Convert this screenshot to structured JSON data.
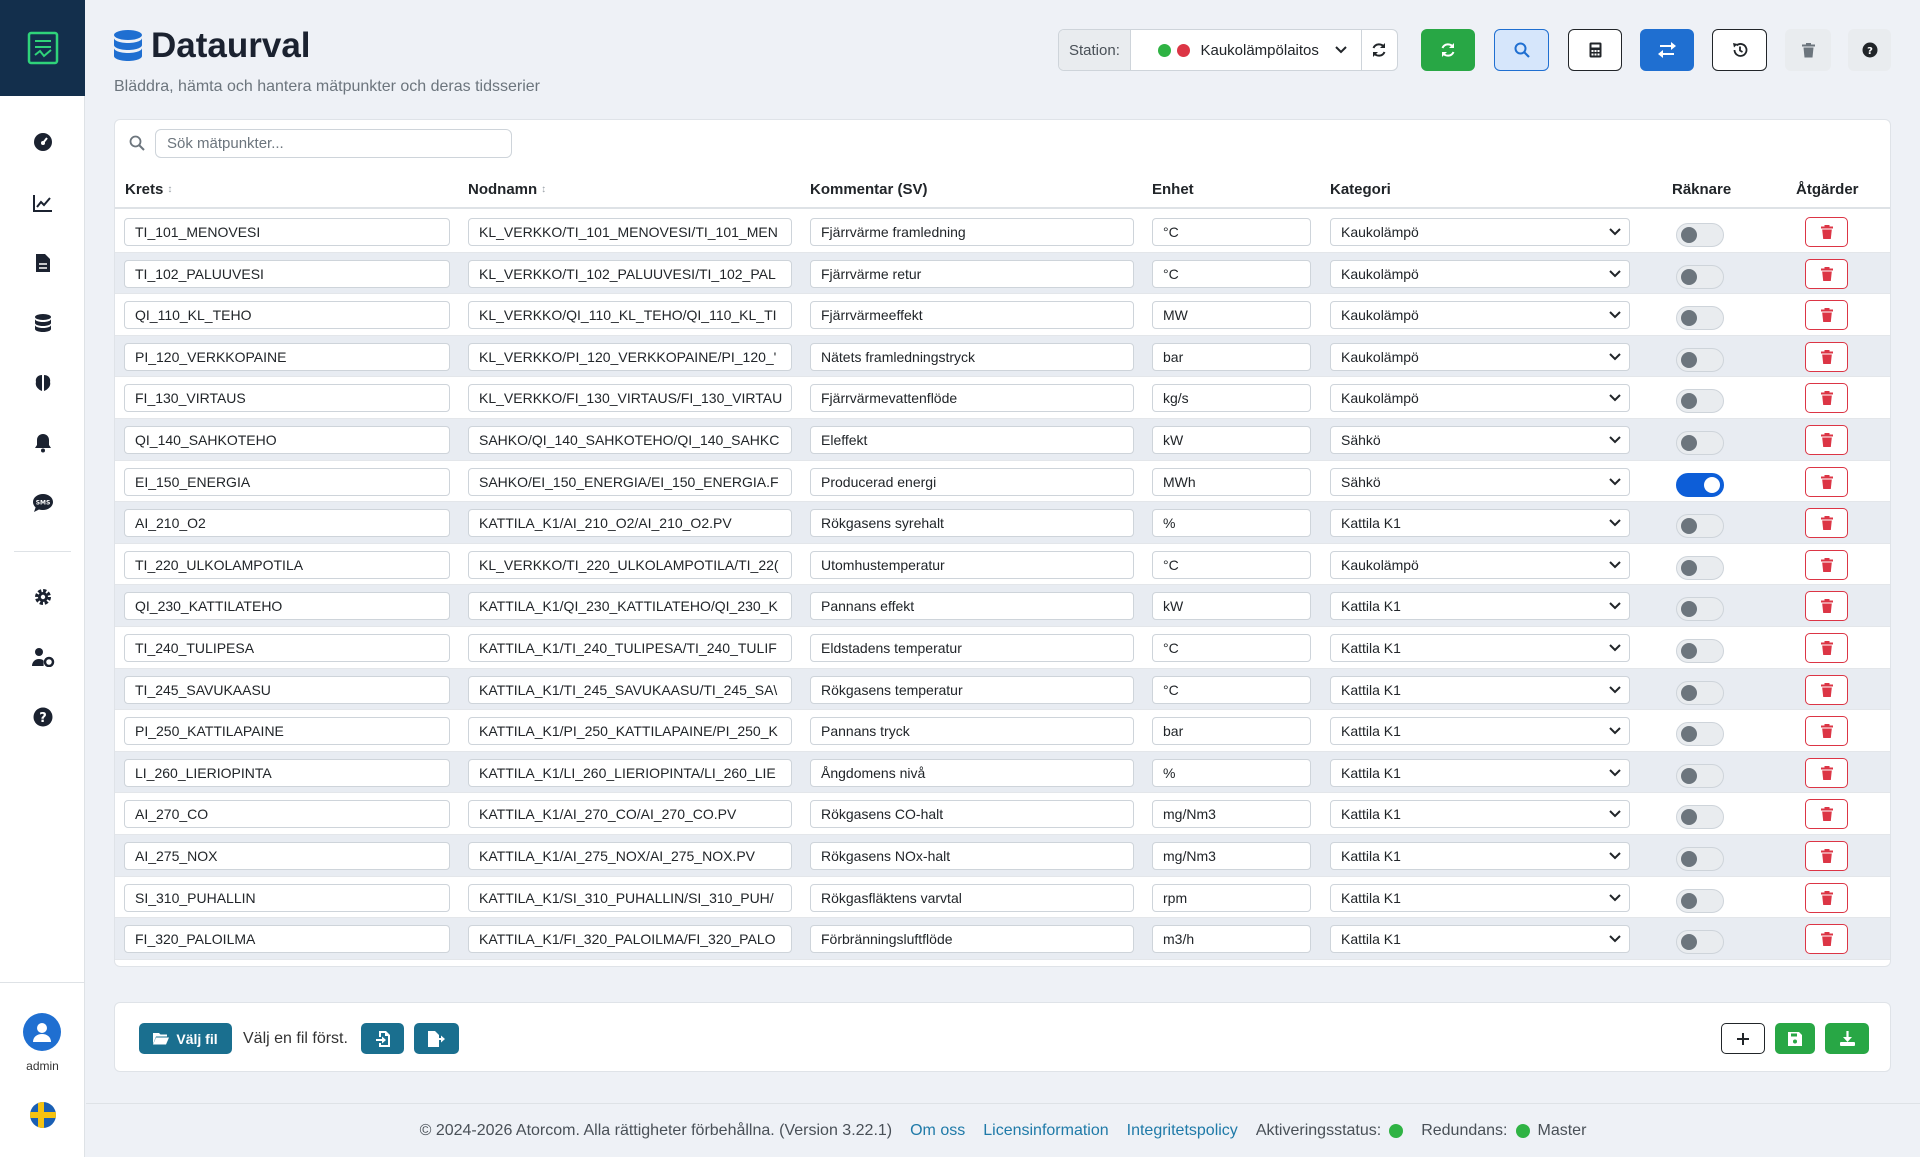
{
  "header": {
    "title": "Dataurval",
    "subtitle": "Bläddra, hämta och hantera mätpunkter och deras tidsserier",
    "station_label": "Station:",
    "station_value": "Kaukolämpölaitos"
  },
  "search": {
    "placeholder": "Sök mätpunkter..."
  },
  "columns": {
    "krets": "Krets",
    "nodnamn": "Nodnamn",
    "kommentar": "Kommentar (SV)",
    "enhet": "Enhet",
    "kategori": "Kategori",
    "raknare": "Räknare",
    "atgarder": "Åtgärder"
  },
  "rows": [
    {
      "krets": "TI_101_MENOVESI",
      "nod": "KL_VERKKO/TI_101_MENOVESI/TI_101_MEN",
      "kommentar": "Fjärrvärme framledning",
      "enhet": "°C",
      "kategori": "Kaukolämpö",
      "raknare": false
    },
    {
      "krets": "TI_102_PALUUVESI",
      "nod": "KL_VERKKO/TI_102_PALUUVESI/TI_102_PAL",
      "kommentar": "Fjärrvärme retur",
      "enhet": "°C",
      "kategori": "Kaukolämpö",
      "raknare": false
    },
    {
      "krets": "QI_110_KL_TEHO",
      "nod": "KL_VERKKO/QI_110_KL_TEHO/QI_110_KL_TI",
      "kommentar": "Fjärrvärmeeffekt",
      "enhet": "MW",
      "kategori": "Kaukolämpö",
      "raknare": false
    },
    {
      "krets": "PI_120_VERKKOPAINE",
      "nod": "KL_VERKKO/PI_120_VERKKOPAINE/PI_120_'",
      "kommentar": "Nätets framledningstryck",
      "enhet": "bar",
      "kategori": "Kaukolämpö",
      "raknare": false
    },
    {
      "krets": "FI_130_VIRTAUS",
      "nod": "KL_VERKKO/FI_130_VIRTAUS/FI_130_VIRTAU",
      "kommentar": "Fjärrvärmevattenflöde",
      "enhet": "kg/s",
      "kategori": "Kaukolämpö",
      "raknare": false
    },
    {
      "krets": "QI_140_SAHKOTEHO",
      "nod": "SAHKO/QI_140_SAHKOTEHO/QI_140_SAHKC",
      "kommentar": "Eleffekt",
      "enhet": "kW",
      "kategori": "Sähkö",
      "raknare": false
    },
    {
      "krets": "EI_150_ENERGIA",
      "nod": "SAHKO/EI_150_ENERGIA/EI_150_ENERGIA.F",
      "kommentar": "Producerad energi",
      "enhet": "MWh",
      "kategori": "Sähkö",
      "raknare": true
    },
    {
      "krets": "AI_210_O2",
      "nod": "KATTILA_K1/AI_210_O2/AI_210_O2.PV",
      "kommentar": "Rökgasens syrehalt",
      "enhet": "%",
      "kategori": "Kattila K1",
      "raknare": false
    },
    {
      "krets": "TI_220_ULKOLAMPOTILA",
      "nod": "KL_VERKKO/TI_220_ULKOLAMPOTILA/TI_22(",
      "kommentar": "Utomhustemperatur",
      "enhet": "°C",
      "kategori": "Kaukolämpö",
      "raknare": false
    },
    {
      "krets": "QI_230_KATTILATEHO",
      "nod": "KATTILA_K1/QI_230_KATTILATEHO/QI_230_K",
      "kommentar": "Pannans effekt",
      "enhet": "kW",
      "kategori": "Kattila K1",
      "raknare": false
    },
    {
      "krets": "TI_240_TULIPESA",
      "nod": "KATTILA_K1/TI_240_TULIPESA/TI_240_TULIF",
      "kommentar": "Eldstadens temperatur",
      "enhet": "°C",
      "kategori": "Kattila K1",
      "raknare": false
    },
    {
      "krets": "TI_245_SAVUKAASU",
      "nod": "KATTILA_K1/TI_245_SAVUKAASU/TI_245_SA\\",
      "kommentar": "Rökgasens temperatur",
      "enhet": "°C",
      "kategori": "Kattila K1",
      "raknare": false
    },
    {
      "krets": "PI_250_KATTILAPAINE",
      "nod": "KATTILA_K1/PI_250_KATTILAPAINE/PI_250_K",
      "kommentar": "Pannans tryck",
      "enhet": "bar",
      "kategori": "Kattila K1",
      "raknare": false
    },
    {
      "krets": "LI_260_LIERIOPINTA",
      "nod": "KATTILA_K1/LI_260_LIERIOPINTA/LI_260_LIE",
      "kommentar": "Ångdomens nivå",
      "enhet": "%",
      "kategori": "Kattila K1",
      "raknare": false
    },
    {
      "krets": "AI_270_CO",
      "nod": "KATTILA_K1/AI_270_CO/AI_270_CO.PV",
      "kommentar": "Rökgasens CO-halt",
      "enhet": "mg/Nm3",
      "kategori": "Kattila K1",
      "raknare": false
    },
    {
      "krets": "AI_275_NOX",
      "nod": "KATTILA_K1/AI_275_NOX/AI_275_NOX.PV",
      "kommentar": "Rökgasens NOx-halt",
      "enhet": "mg/Nm3",
      "kategori": "Kattila K1",
      "raknare": false
    },
    {
      "krets": "SI_310_PUHALLIN",
      "nod": "KATTILA_K1/SI_310_PUHALLIN/SI_310_PUH/",
      "kommentar": "Rökgasfläktens varvtal",
      "enhet": "rpm",
      "kategori": "Kattila K1",
      "raknare": false
    },
    {
      "krets": "FI_320_PALOILMA",
      "nod": "KATTILA_K1/FI_320_PALOILMA/FI_320_PALO",
      "kommentar": "Förbränningsluftflöde",
      "enhet": "m3/h",
      "kategori": "Kattila K1",
      "raknare": false
    }
  ],
  "footer": {
    "choose_file": "Välj fil",
    "file_status": "Välj en fil först."
  },
  "bottom": {
    "copyright": "© 2024-2026 Atorcom. Alla rättigheter förbehållna. (Version 3.22.1)",
    "about": "Om oss",
    "license": "Licensinformation",
    "privacy": "Integritetspolicy",
    "activation": "Aktiveringsstatus:",
    "redundancy": "Redundans:",
    "master": "Master"
  },
  "user": {
    "name": "admin"
  },
  "colors": {
    "primary": "#1f6fd1",
    "success": "#28a745",
    "danger": "#dc3545",
    "sidebar_logo_bg": "#132f4c"
  },
  "icons": [
    "dashboard-icon",
    "chart-icon",
    "document-icon",
    "database-icon",
    "brain-icon",
    "bell-icon",
    "sms-icon",
    "gear-icon",
    "user-gear-icon",
    "help-icon"
  ]
}
